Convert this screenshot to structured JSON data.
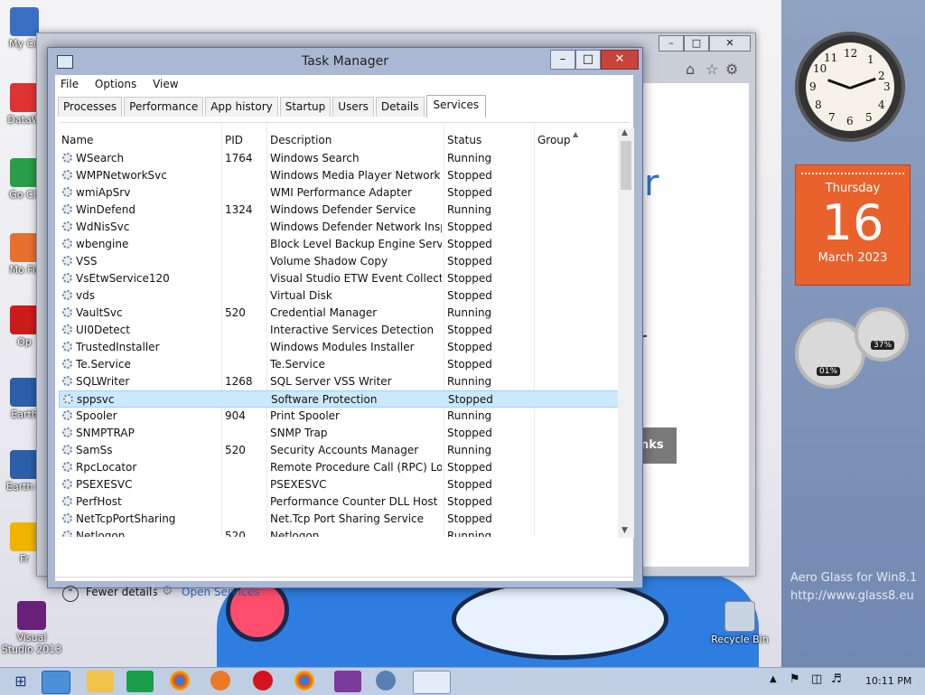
{
  "desktop": {
    "icons": [
      {
        "label": "My Co",
        "glyph": "computer-icon"
      },
      {
        "label": "DataW",
        "glyph": "shortcut-icon"
      },
      {
        "label": "Go Ch",
        "glyph": "chrome-shortcut-icon"
      },
      {
        "label": "Mo Fir",
        "glyph": "firefox-shortcut-icon"
      },
      {
        "label": "Op",
        "glyph": "opera-shortcut-icon"
      },
      {
        "label": "Earth",
        "glyph": "earth-shortcut-icon"
      },
      {
        "label": "Earth 8",
        "glyph": "earth-shortcut-icon"
      },
      {
        "label": "Fr",
        "glyph": "shortcut-icon"
      },
      {
        "label": "Visual Studio 2013",
        "glyph": "visual-studio-icon"
      },
      {
        "label": "Recycle Bin",
        "glyph": "recycle-bin-icon"
      }
    ],
    "watermark": {
      "line1": "Aero Glass for Win8.1",
      "line2": "http://www.glass8.eu"
    }
  },
  "background_window": {
    "partial_texts": {
      "r1": "r",
      "r2": "r",
      "button": "nks"
    }
  },
  "task_manager": {
    "title": "Task Manager",
    "menu": [
      "File",
      "Options",
      "View"
    ],
    "tabs": [
      "Processes",
      "Performance",
      "App history",
      "Startup",
      "Users",
      "Details",
      "Services"
    ],
    "active_tab": "Services",
    "columns": [
      "Name",
      "PID",
      "Description",
      "Status",
      "Group"
    ],
    "services": [
      {
        "name": "WSearch",
        "pid": "1764",
        "description": "Windows Search",
        "status": "Running"
      },
      {
        "name": "WMPNetworkSvc",
        "pid": "",
        "description": "Windows Media Player Network ...",
        "status": "Stopped"
      },
      {
        "name": "wmiApSrv",
        "pid": "",
        "description": "WMI Performance Adapter",
        "status": "Stopped"
      },
      {
        "name": "WinDefend",
        "pid": "1324",
        "description": "Windows Defender Service",
        "status": "Running"
      },
      {
        "name": "WdNisSvc",
        "pid": "",
        "description": "Windows Defender Network Insp...",
        "status": "Stopped"
      },
      {
        "name": "wbengine",
        "pid": "",
        "description": "Block Level Backup Engine Service",
        "status": "Stopped"
      },
      {
        "name": "VSS",
        "pid": "",
        "description": "Volume Shadow Copy",
        "status": "Stopped"
      },
      {
        "name": "VsEtwService120",
        "pid": "",
        "description": "Visual Studio ETW Event Collecti...",
        "status": "Stopped"
      },
      {
        "name": "vds",
        "pid": "",
        "description": "Virtual Disk",
        "status": "Stopped"
      },
      {
        "name": "VaultSvc",
        "pid": "520",
        "description": "Credential Manager",
        "status": "Running"
      },
      {
        "name": "UI0Detect",
        "pid": "",
        "description": "Interactive Services Detection",
        "status": "Stopped"
      },
      {
        "name": "TrustedInstaller",
        "pid": "",
        "description": "Windows Modules Installer",
        "status": "Stopped"
      },
      {
        "name": "Te.Service",
        "pid": "",
        "description": "Te.Service",
        "status": "Stopped"
      },
      {
        "name": "SQLWriter",
        "pid": "1268",
        "description": "SQL Server VSS Writer",
        "status": "Running"
      },
      {
        "name": "sppsvc",
        "pid": "",
        "description": "Software Protection",
        "status": "Stopped"
      },
      {
        "name": "Spooler",
        "pid": "904",
        "description": "Print Spooler",
        "status": "Running"
      },
      {
        "name": "SNMPTRAP",
        "pid": "",
        "description": "SNMP Trap",
        "status": "Stopped"
      },
      {
        "name": "SamSs",
        "pid": "520",
        "description": "Security Accounts Manager",
        "status": "Running"
      },
      {
        "name": "RpcLocator",
        "pid": "",
        "description": "Remote Procedure Call (RPC) Lo...",
        "status": "Stopped"
      },
      {
        "name": "PSEXESVC",
        "pid": "",
        "description": "PSEXESVC",
        "status": "Stopped"
      },
      {
        "name": "PerfHost",
        "pid": "",
        "description": "Performance Counter DLL Host",
        "status": "Stopped"
      },
      {
        "name": "NetTcpPortSharing",
        "pid": "",
        "description": "Net.Tcp Port Sharing Service",
        "status": "Stopped"
      },
      {
        "name": "Netlogon",
        "pid": "520",
        "description": "Netlogon",
        "status": "Running"
      }
    ],
    "selected_service": "sppsvc",
    "footer": {
      "fewer_details": "Fewer details",
      "open_services": "Open Services"
    }
  },
  "gadgets": {
    "clock": {
      "numerals": [
        "12",
        "1",
        "2",
        "3",
        "4",
        "5",
        "6",
        "7",
        "8",
        "9",
        "10",
        "11"
      ]
    },
    "calendar": {
      "weekday": "Thursday",
      "day": "16",
      "month_year": "March 2023"
    },
    "meters": {
      "cpu": "01%",
      "memory": "37%"
    }
  },
  "taskbar": {
    "time": "10:11 PM",
    "apps": [
      "internet-explorer-icon",
      "file-explorer-icon",
      "store-icon",
      "chrome-icon",
      "firefox-icon",
      "opera-icon",
      "chrome-icon",
      "visual-studio-icon",
      "globe-icon",
      "task-manager-icon"
    ]
  }
}
